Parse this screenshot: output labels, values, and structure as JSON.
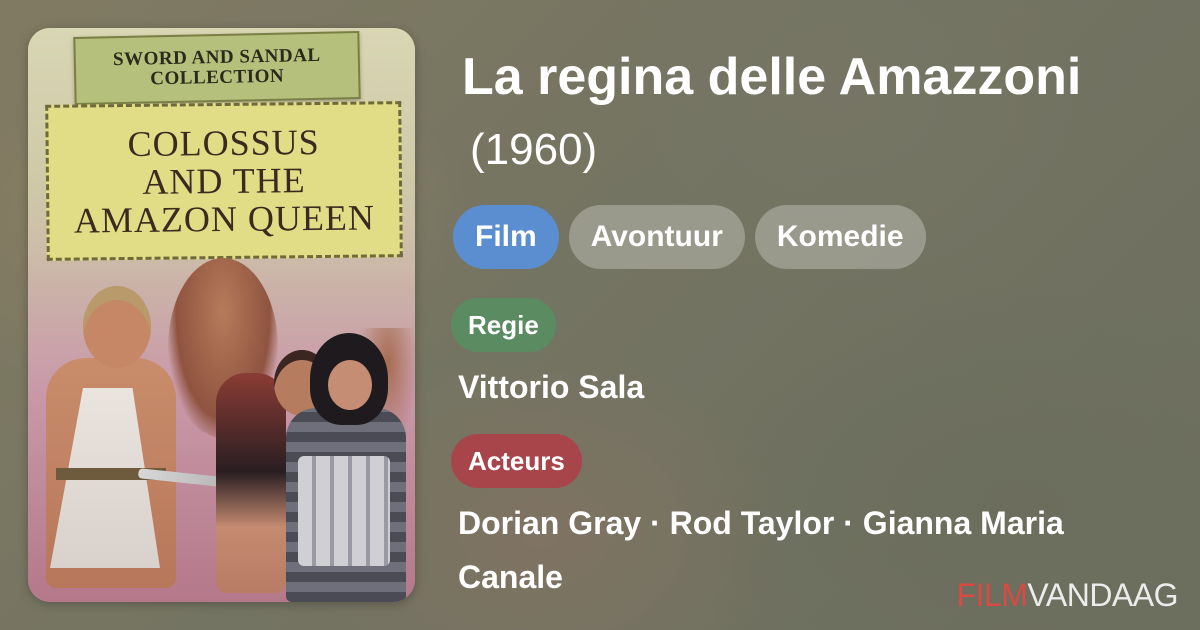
{
  "poster": {
    "collection_label": "SWORD AND SANDAL\nCOLLECTION",
    "title_art": "COLOSSUS\nAND THE\nAMAZON QUEEN"
  },
  "movie": {
    "title": "La regina delle Amazzoni",
    "year": "(1960)"
  },
  "tags": [
    {
      "label": "Film",
      "color": "#5a8ed0"
    },
    {
      "label": "Avontuur"
    },
    {
      "label": "Komedie"
    }
  ],
  "director_section": {
    "label": "Regie",
    "label_color": "#5b8b61",
    "names": "Vittorio Sala"
  },
  "actors_section": {
    "label": "Acteurs",
    "label_color": "#a8454b",
    "names": "Dorian Gray · Rod Taylor · Gianna Maria Canale"
  },
  "brand": {
    "part1": "FILM",
    "part2": "VANDAAG",
    "part1_color": "#d84a43"
  }
}
